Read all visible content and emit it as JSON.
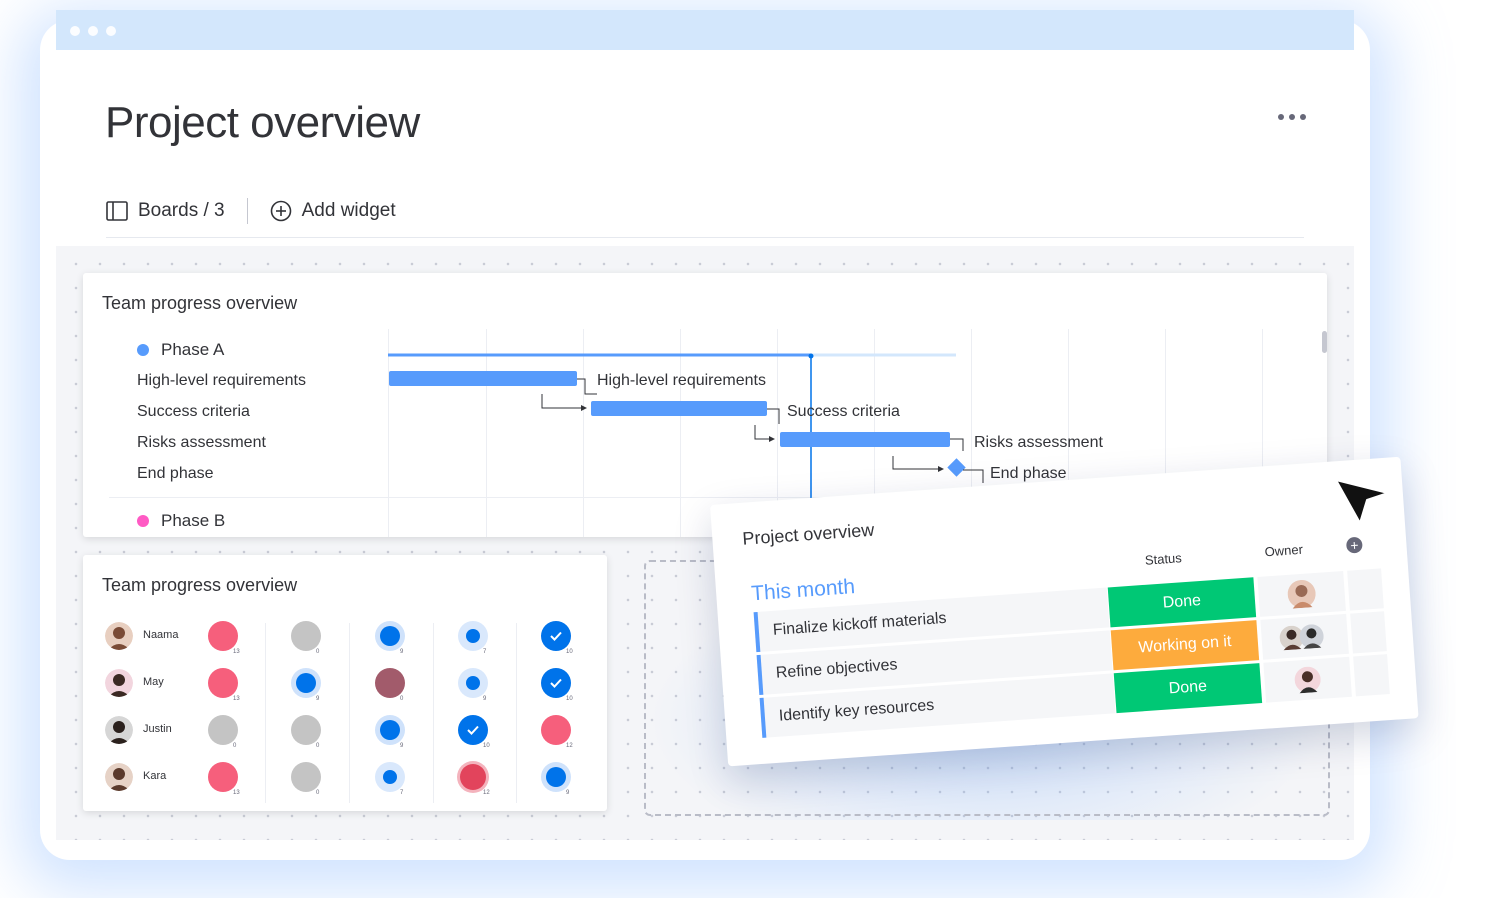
{
  "page": {
    "title": "Project overview"
  },
  "toolbar": {
    "boards_label": "Boards / 3",
    "add_widget_label": "Add widget"
  },
  "gantt": {
    "title": "Team progress overview",
    "phases": [
      {
        "label": "Phase A",
        "color": "#579bfc"
      },
      {
        "label": "Phase B",
        "color": "#ff5ac4"
      }
    ],
    "rows": [
      "High-level requirements",
      "Success criteria",
      "Risks assessment",
      "End phase"
    ],
    "bar_labels": [
      "High-level requirements",
      "Success criteria",
      "Risks assessment",
      "End phase"
    ],
    "bar_color": "#579bfc"
  },
  "progress": {
    "title": "Team progress overview",
    "people": [
      {
        "name": "Naama",
        "counts": [
          "13",
          "0",
          "9",
          "7",
          "10"
        ]
      },
      {
        "name": "May",
        "counts": [
          "13",
          "9",
          "0",
          "9",
          "10"
        ]
      },
      {
        "name": "Justin",
        "counts": [
          "0",
          "0",
          "9",
          "10",
          "12"
        ]
      },
      {
        "name": "Kara",
        "counts": [
          "13",
          "0",
          "7",
          "12",
          "9"
        ]
      }
    ]
  },
  "float": {
    "title": "Project overview",
    "group": "This month",
    "headers": {
      "status": "Status",
      "owner": "Owner"
    },
    "tasks": [
      {
        "name": "Finalize kickoff materials",
        "status": "Done",
        "status_color": "#00c875"
      },
      {
        "name": "Refine objectives",
        "status": "Working on it",
        "status_color": "#fdab3d"
      },
      {
        "name": "Identify key resources",
        "status": "Done",
        "status_color": "#00c875"
      }
    ]
  },
  "colors": {
    "accent": "#579bfc",
    "done": "#00c875",
    "working": "#fdab3d",
    "stuck": "#e2445c"
  }
}
